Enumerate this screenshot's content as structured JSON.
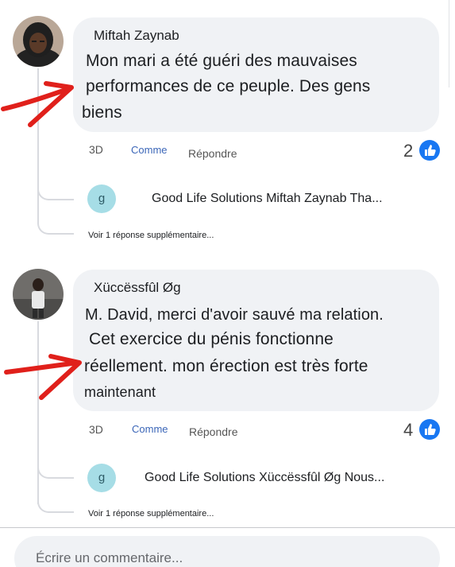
{
  "comments": [
    {
      "author": "Miftah Zaynab",
      "body_lines": [
        "Mon mari a été guéri des mauvaises",
        "performances de ce peuple. Des gens",
        "biens"
      ],
      "time": "3D",
      "like_label": "Comme",
      "reply_label": "Répondre",
      "reaction_count": "2",
      "reply": {
        "avatar_letter": "g",
        "preview": "Good Life Solutions Miftah Zaynab Tha..."
      },
      "more_replies": "Voir 1 réponse supplémentaire..."
    },
    {
      "author": "Xüccëssfûl Øg",
      "body_lines": [
        "M. David, merci d'avoir sauvé ma relation.",
        "Cet exercice du pénis fonctionne",
        "réellement. mon érection est très forte",
        "maintenant"
      ],
      "time": "3D",
      "like_label": "Comme",
      "reply_label": "Répondre",
      "reaction_count": "4",
      "reply": {
        "avatar_letter": "g",
        "preview": "Good Life Solutions Xüccëssfûl Øg Nous..."
      },
      "more_replies": "Voir 1 réponse supplémentaire..."
    }
  ],
  "composer": {
    "placeholder": "Écrire un commentaire..."
  },
  "colors": {
    "like_blue": "#1877f2",
    "annotation_red": "#e0201b",
    "bubble_bg": "#f0f2f5"
  },
  "icons": {
    "reaction": "thumbs-up-icon",
    "annotation": "red-arrow-annotation"
  }
}
